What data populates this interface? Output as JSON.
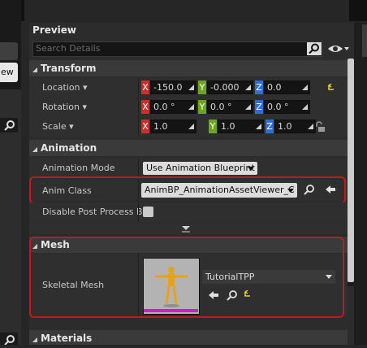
{
  "panel": {
    "title": "Preview",
    "search_placeholder": "Search Details"
  },
  "left_panel": {
    "button_label": "ew"
  },
  "sections": {
    "transform": "Transform",
    "animation": "Animation",
    "mesh": "Mesh",
    "materials": "Materials"
  },
  "transform": {
    "location": {
      "label": "Location",
      "x": "-150.0",
      "y": "-0.000",
      "z": "0.0"
    },
    "rotation": {
      "label": "Rotation",
      "x": "0.0 °",
      "y": "0.0 °",
      "z": "0.0 °"
    },
    "scale": {
      "label": "Scale",
      "x": "1.0",
      "y": "1.0",
      "z": "1.0"
    },
    "axis_labels": {
      "x": "X",
      "y": "Y",
      "z": "Z"
    }
  },
  "animation": {
    "mode_label": "Animation Mode",
    "mode_value": "Use Animation Blueprint",
    "anim_class_label": "Anim Class",
    "anim_class_value": "AnimBP_AnimationAssetViewer_C",
    "disable_pp_label": "Disable Post Process B"
  },
  "mesh": {
    "skeletal_mesh_label": "Skeletal Mesh",
    "skeletal_mesh_value": "TutorialTPP"
  },
  "colors": {
    "x_axis": "#c9302c",
    "y_axis": "#6aa51c",
    "z_axis": "#2e6ed1",
    "highlight": "#c8161d",
    "thumbnail_bar": "#d11ad1"
  },
  "icons": [
    "search-icon",
    "eye-icon",
    "reset-arrow-icon",
    "lock-icon",
    "browse-icon",
    "use-selected-icon",
    "chevron-down-icon"
  ]
}
